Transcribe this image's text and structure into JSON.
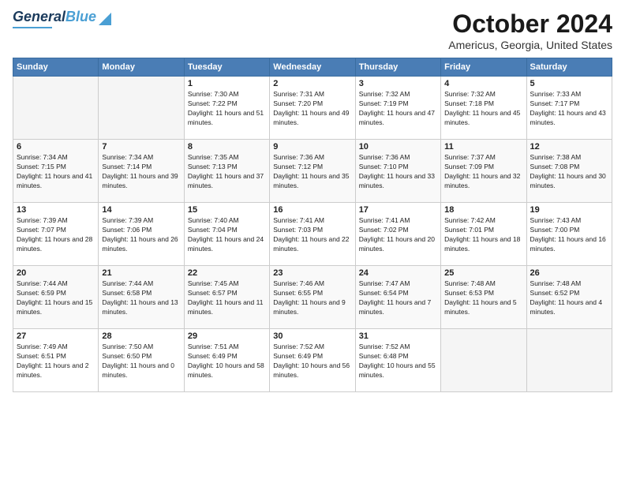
{
  "header": {
    "logo_general": "General",
    "logo_blue": "Blue",
    "month_title": "October 2024",
    "location": "Americus, Georgia, United States"
  },
  "days_of_week": [
    "Sunday",
    "Monday",
    "Tuesday",
    "Wednesday",
    "Thursday",
    "Friday",
    "Saturday"
  ],
  "weeks": [
    [
      {
        "num": "",
        "info": ""
      },
      {
        "num": "",
        "info": ""
      },
      {
        "num": "1",
        "info": "Sunrise: 7:30 AM\nSunset: 7:22 PM\nDaylight: 11 hours and 51 minutes."
      },
      {
        "num": "2",
        "info": "Sunrise: 7:31 AM\nSunset: 7:20 PM\nDaylight: 11 hours and 49 minutes."
      },
      {
        "num": "3",
        "info": "Sunrise: 7:32 AM\nSunset: 7:19 PM\nDaylight: 11 hours and 47 minutes."
      },
      {
        "num": "4",
        "info": "Sunrise: 7:32 AM\nSunset: 7:18 PM\nDaylight: 11 hours and 45 minutes."
      },
      {
        "num": "5",
        "info": "Sunrise: 7:33 AM\nSunset: 7:17 PM\nDaylight: 11 hours and 43 minutes."
      }
    ],
    [
      {
        "num": "6",
        "info": "Sunrise: 7:34 AM\nSunset: 7:15 PM\nDaylight: 11 hours and 41 minutes."
      },
      {
        "num": "7",
        "info": "Sunrise: 7:34 AM\nSunset: 7:14 PM\nDaylight: 11 hours and 39 minutes."
      },
      {
        "num": "8",
        "info": "Sunrise: 7:35 AM\nSunset: 7:13 PM\nDaylight: 11 hours and 37 minutes."
      },
      {
        "num": "9",
        "info": "Sunrise: 7:36 AM\nSunset: 7:12 PM\nDaylight: 11 hours and 35 minutes."
      },
      {
        "num": "10",
        "info": "Sunrise: 7:36 AM\nSunset: 7:10 PM\nDaylight: 11 hours and 33 minutes."
      },
      {
        "num": "11",
        "info": "Sunrise: 7:37 AM\nSunset: 7:09 PM\nDaylight: 11 hours and 32 minutes."
      },
      {
        "num": "12",
        "info": "Sunrise: 7:38 AM\nSunset: 7:08 PM\nDaylight: 11 hours and 30 minutes."
      }
    ],
    [
      {
        "num": "13",
        "info": "Sunrise: 7:39 AM\nSunset: 7:07 PM\nDaylight: 11 hours and 28 minutes."
      },
      {
        "num": "14",
        "info": "Sunrise: 7:39 AM\nSunset: 7:06 PM\nDaylight: 11 hours and 26 minutes."
      },
      {
        "num": "15",
        "info": "Sunrise: 7:40 AM\nSunset: 7:04 PM\nDaylight: 11 hours and 24 minutes."
      },
      {
        "num": "16",
        "info": "Sunrise: 7:41 AM\nSunset: 7:03 PM\nDaylight: 11 hours and 22 minutes."
      },
      {
        "num": "17",
        "info": "Sunrise: 7:41 AM\nSunset: 7:02 PM\nDaylight: 11 hours and 20 minutes."
      },
      {
        "num": "18",
        "info": "Sunrise: 7:42 AM\nSunset: 7:01 PM\nDaylight: 11 hours and 18 minutes."
      },
      {
        "num": "19",
        "info": "Sunrise: 7:43 AM\nSunset: 7:00 PM\nDaylight: 11 hours and 16 minutes."
      }
    ],
    [
      {
        "num": "20",
        "info": "Sunrise: 7:44 AM\nSunset: 6:59 PM\nDaylight: 11 hours and 15 minutes."
      },
      {
        "num": "21",
        "info": "Sunrise: 7:44 AM\nSunset: 6:58 PM\nDaylight: 11 hours and 13 minutes."
      },
      {
        "num": "22",
        "info": "Sunrise: 7:45 AM\nSunset: 6:57 PM\nDaylight: 11 hours and 11 minutes."
      },
      {
        "num": "23",
        "info": "Sunrise: 7:46 AM\nSunset: 6:55 PM\nDaylight: 11 hours and 9 minutes."
      },
      {
        "num": "24",
        "info": "Sunrise: 7:47 AM\nSunset: 6:54 PM\nDaylight: 11 hours and 7 minutes."
      },
      {
        "num": "25",
        "info": "Sunrise: 7:48 AM\nSunset: 6:53 PM\nDaylight: 11 hours and 5 minutes."
      },
      {
        "num": "26",
        "info": "Sunrise: 7:48 AM\nSunset: 6:52 PM\nDaylight: 11 hours and 4 minutes."
      }
    ],
    [
      {
        "num": "27",
        "info": "Sunrise: 7:49 AM\nSunset: 6:51 PM\nDaylight: 11 hours and 2 minutes."
      },
      {
        "num": "28",
        "info": "Sunrise: 7:50 AM\nSunset: 6:50 PM\nDaylight: 11 hours and 0 minutes."
      },
      {
        "num": "29",
        "info": "Sunrise: 7:51 AM\nSunset: 6:49 PM\nDaylight: 10 hours and 58 minutes."
      },
      {
        "num": "30",
        "info": "Sunrise: 7:52 AM\nSunset: 6:49 PM\nDaylight: 10 hours and 56 minutes."
      },
      {
        "num": "31",
        "info": "Sunrise: 7:52 AM\nSunset: 6:48 PM\nDaylight: 10 hours and 55 minutes."
      },
      {
        "num": "",
        "info": ""
      },
      {
        "num": "",
        "info": ""
      }
    ]
  ]
}
